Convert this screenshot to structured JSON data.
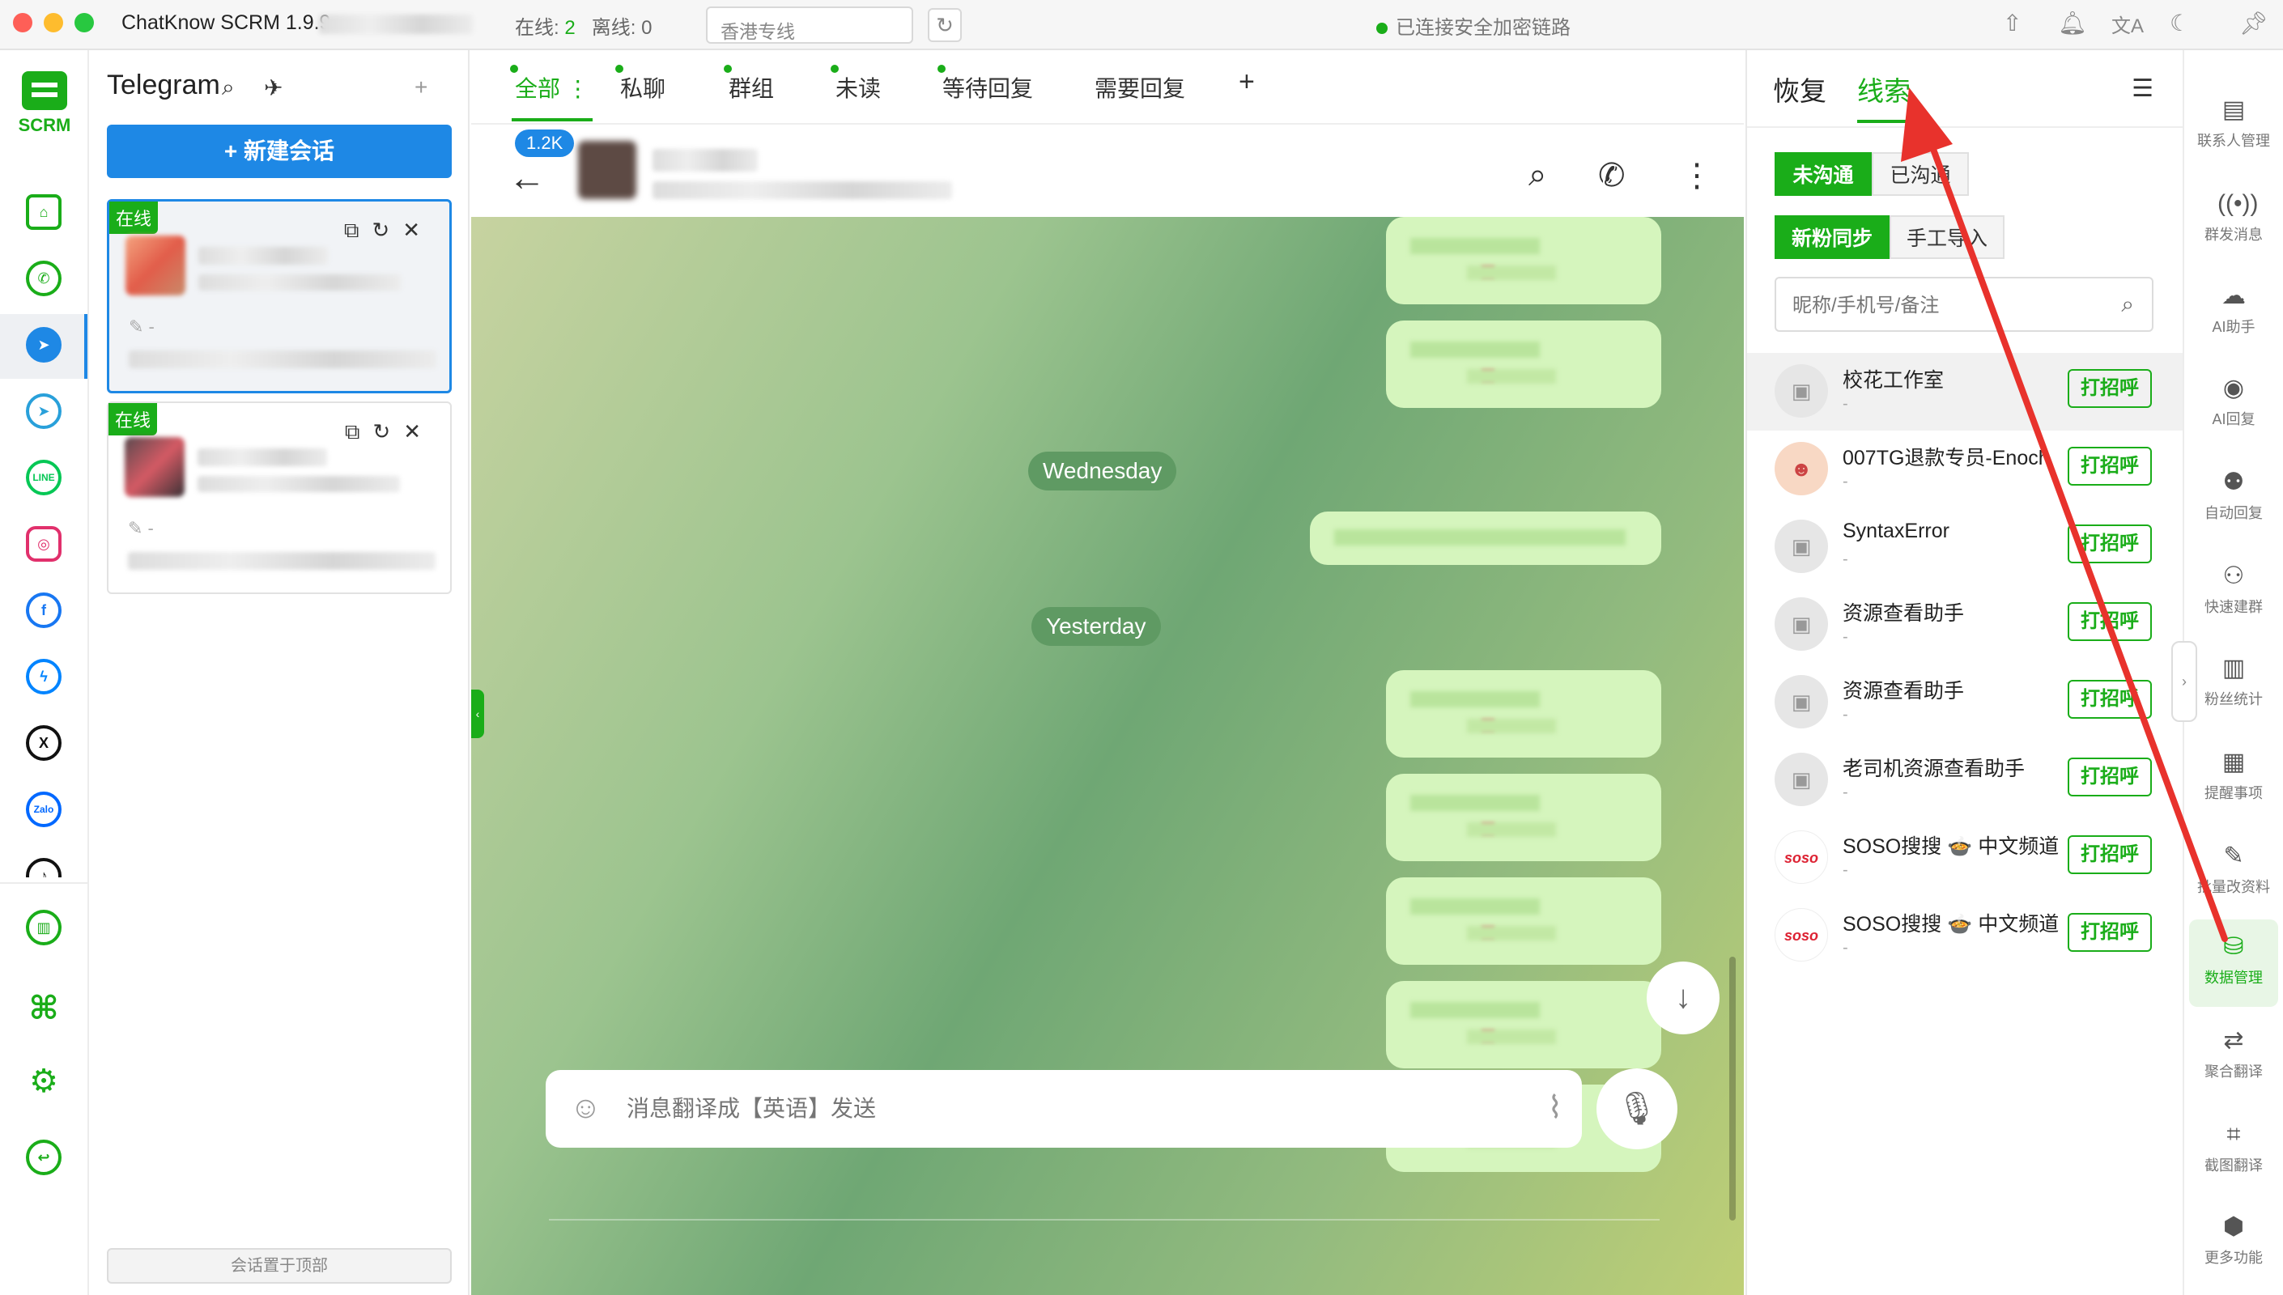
{
  "titlebar": {
    "app_title": "ChatKnow SCRM 1.9.9",
    "online_label": "在线:",
    "online_count": "2",
    "offline_label": "离线:",
    "offline_count": "0",
    "region_value": "香港专线",
    "secure_status": "已连接安全加密链路"
  },
  "logo": {
    "text": "SCRM"
  },
  "rail": {
    "items": [
      {
        "name": "home-icon"
      },
      {
        "name": "whatsapp-icon"
      },
      {
        "name": "telegram-icon"
      },
      {
        "name": "telegram-alt-icon"
      },
      {
        "name": "line-icon",
        "label": "LINE"
      },
      {
        "name": "instagram-icon"
      },
      {
        "name": "facebook-icon",
        "label": "f"
      },
      {
        "name": "messenger-icon"
      },
      {
        "name": "x-icon",
        "label": "X"
      },
      {
        "name": "zalo-icon",
        "label": "Zalo"
      },
      {
        "name": "tiktok-icon"
      }
    ]
  },
  "session_panel": {
    "title": "Telegram",
    "new_chat_label": "+ 新建会话",
    "accounts": [
      {
        "badge": "在线",
        "note": "-"
      },
      {
        "badge": "在线",
        "note": "-"
      }
    ],
    "pin_label": "会话置于顶部"
  },
  "chat": {
    "tabs": [
      "全部",
      "私聊",
      "群组",
      "未读",
      "等待回复",
      "需要回复"
    ],
    "add_tab_label": "+",
    "unread_count": "1.2K",
    "date_wednesday": "Wednesday",
    "date_yesterday": "Yesterday",
    "input_placeholder": "消息翻译成【英语】发送"
  },
  "right_panel": {
    "tabs": [
      "恢复",
      "线索"
    ],
    "filter_a": [
      "未沟通",
      "已沟通"
    ],
    "filter_b": [
      "新粉同步",
      "手工导入"
    ],
    "search_placeholder": "昵称/手机号/备注",
    "greet_label": "打招呼",
    "leads": [
      {
        "name": "校花工作室",
        "sub": "-"
      },
      {
        "name": "007TG退款专员-Enoch",
        "sub": "-"
      },
      {
        "name": "SyntaxError",
        "sub": "-"
      },
      {
        "name": "资源查看助手",
        "sub": "-"
      },
      {
        "name": "资源查看助手",
        "sub": "-"
      },
      {
        "name": "老司机资源查看助手",
        "sub": "-"
      },
      {
        "name": "SOSO搜搜 🍲 中文频道",
        "sub": "-"
      },
      {
        "name": "SOSO搜搜 🍲 中文频道",
        "sub": "-"
      }
    ]
  },
  "tools": [
    {
      "label": "联系人管理",
      "icon": "contacts-icon"
    },
    {
      "label": "群发消息",
      "icon": "broadcast-icon"
    },
    {
      "label": "AI助手",
      "icon": "ai-assistant-icon"
    },
    {
      "label": "AI回复",
      "icon": "ai-reply-icon"
    },
    {
      "label": "自动回复",
      "icon": "robot-icon"
    },
    {
      "label": "快速建群",
      "icon": "group-icon"
    },
    {
      "label": "粉丝统计",
      "icon": "stats-icon"
    },
    {
      "label": "提醒事项",
      "icon": "calendar-icon"
    },
    {
      "label": "批量改资料",
      "icon": "edit-doc-icon"
    },
    {
      "label": "数据管理",
      "icon": "data-icon"
    },
    {
      "label": "聚合翻译",
      "icon": "translate-icon"
    },
    {
      "label": "截图翻译",
      "icon": "crop-icon"
    },
    {
      "label": "更多功能",
      "icon": "box-icon"
    }
  ],
  "colors": {
    "accent": "#1aad19",
    "primary_blue": "#1e88e5",
    "annotation_arrow": "#e8322c"
  }
}
